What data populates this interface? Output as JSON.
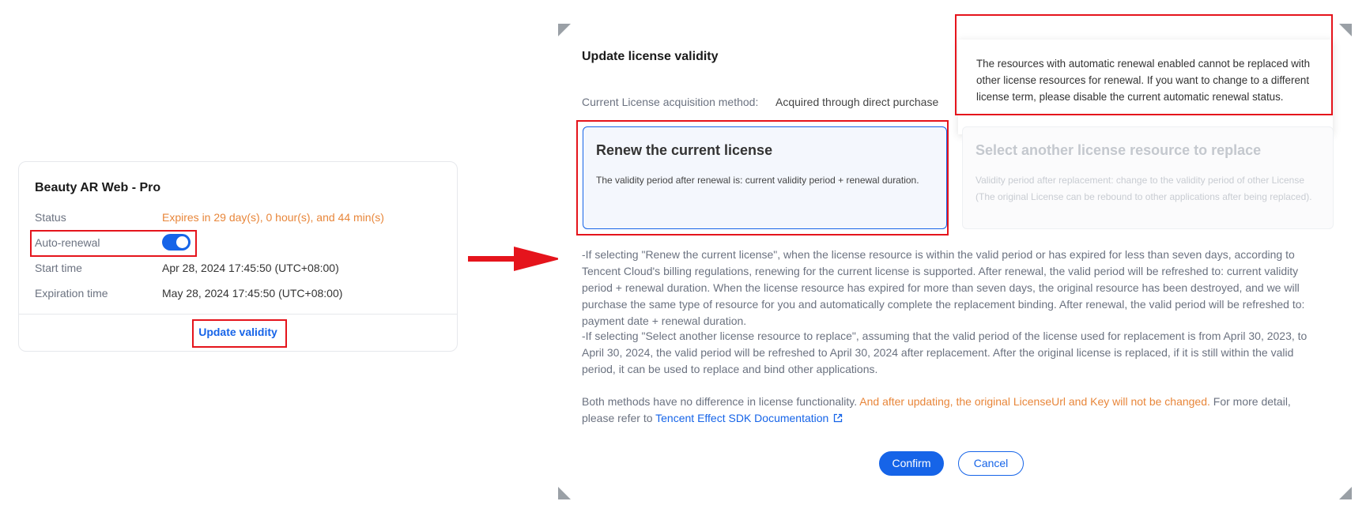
{
  "card": {
    "title": "Beauty AR Web - Pro",
    "rows": [
      {
        "label": "Status",
        "value": "Expires in 29 day(s), 0 hour(s), and 44 min(s)"
      },
      {
        "label": "Auto-renewal",
        "value": "on"
      },
      {
        "label": "Start time",
        "value": "Apr 28, 2024 17:45:50 (UTC+08:00)"
      },
      {
        "label": "Expiration time",
        "value": "May 28, 2024 17:45:50 (UTC+08:00)"
      }
    ],
    "update_link": "Update validity"
  },
  "dialog": {
    "title": "Update license validity",
    "method_label": "Current License acquisition method:",
    "method_value": "Acquired through direct purchase",
    "tooltip": "The resources with automatic renewal enabled cannot be replaced with other license resources for renewal. If you want to change to a different license term, please disable the current automatic renewal status.",
    "options": [
      {
        "title": "Renew the current license",
        "desc": "The validity period after renewal is: current validity period + renewal duration."
      },
      {
        "title": "Select another license resource to replace",
        "desc": "Validity period after replacement: change to the validity period of other License (The original License can be rebound to other applications after being replaced)."
      }
    ],
    "para1": "-If selecting \"Renew the current license\", when the license resource is within the valid period or has expired for less than seven days, according to Tencent Cloud's billing regulations, renewing for the current license is supported. After renewal, the valid period will be refreshed to: current validity period + renewal duration. When the license resource has expired for more than seven days, the original resource has been destroyed, and we will purchase the same type of resource for you and automatically complete the replacement binding. After renewal, the valid period will be refreshed to: payment date + renewal duration.",
    "para2": "-If selecting \"Select another license resource to replace\", assuming that the valid period of the license used for replacement is from April 30, 2023, to April 30, 2024, the valid period will be refreshed to April 30, 2024 after replacement. After the original license is replaced, if it is still within the valid period, it can be used to replace and bind other applications.",
    "para3_a": "Both methods have no difference in license functionality.",
    "para3_orange": "And after updating, the original LicenseUrl and Key will not be changed.",
    "para3_b": " For more detail, please refer to",
    "doc_link": "Tencent Effect SDK Documentation",
    "confirm": "Confirm",
    "cancel": "Cancel"
  },
  "colors": {
    "accent": "#1664e8",
    "warning": "#e8863a",
    "highlight": "#e5141c"
  }
}
